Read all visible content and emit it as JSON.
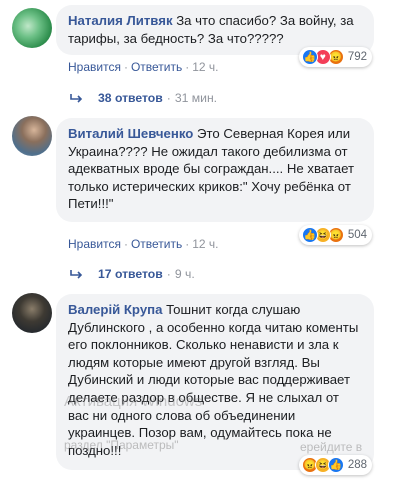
{
  "comments": [
    {
      "author": "Наталия Литвяк",
      "text": "За что спасибо? За войну, за тарифы, за бедность? За что?????",
      "reaction_count": "792",
      "like_label": "Нравится",
      "reply_label": "Ответить",
      "time": "12 ч.",
      "replies_label": "38 ответов",
      "replies_time": "31 мин."
    },
    {
      "author": "Виталий Шевченко",
      "text": "Это Северная Корея или Украина???? Не ожидал такого дебилизма от адекватных вроде бы сограждан.... Не хватает только истерических криков:\" Хочу ребёнка от Пети!!!\"",
      "reaction_count": "504",
      "like_label": "Нравится",
      "reply_label": "Ответить",
      "time": "12 ч.",
      "replies_label": "17 ответов",
      "replies_time": "9 ч."
    },
    {
      "author": "Валерій Крупа",
      "text": "Тошнит когда слушаю Дублинского , а особенно когда читаю коменты его поклонников. Сколько ненависти и зла к людям которые имеют другой взгляд. Вы Дубинский и люди которые вас поддерживает делаете раздор в обществе. Я не слыхал от вас ни одного слова об объединении украинцев. Позор вам, одумайтесь пока не поздно!!!",
      "reaction_count": "288"
    }
  ],
  "watermark": {
    "line1": "Активация Windows",
    "line2": "раздел \"Параметры\"",
    "line3": "ерейдите в"
  },
  "colors": {
    "link": "#385898",
    "bubble": "#f2f3f5",
    "like": "#1877f2",
    "love": "#f33e58",
    "angry": "#e9710f",
    "haha": "#f7b125"
  }
}
